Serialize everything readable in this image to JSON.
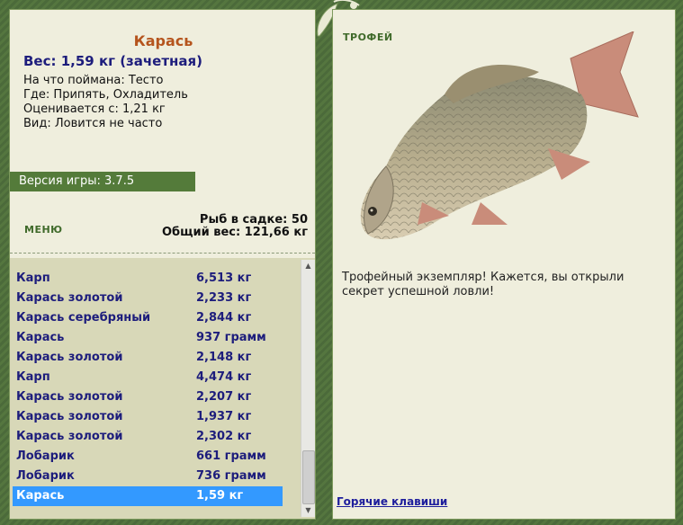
{
  "left": {
    "fish_name": "Карась",
    "weight_line": "Вес: 1,59 кг (зачетная)",
    "info": [
      "На что поймана: Тесто",
      "Где: Припять, Охладитель",
      "Оценивается с: 1,21 кг",
      "Вид: Ловится не часто"
    ],
    "version": "Версия игры: 3.7.5",
    "menu_label": "МЕНЮ",
    "stats": {
      "keepnet": "Рыб в садке: 50",
      "total": "Общий вес: 121,66 кг"
    }
  },
  "catch_list": [
    {
      "name": "Карп",
      "weight": "6,513 кг"
    },
    {
      "name": "Карась золотой",
      "weight": "2,233 кг"
    },
    {
      "name": "Карась серебряный",
      "weight": "2,844 кг"
    },
    {
      "name": "Карась",
      "weight": "937 грамм"
    },
    {
      "name": "Карась золотой",
      "weight": "2,148 кг"
    },
    {
      "name": "Карп",
      "weight": "4,474 кг"
    },
    {
      "name": "Карась золотой",
      "weight": "2,207 кг"
    },
    {
      "name": "Карась золотой",
      "weight": "1,937 кг"
    },
    {
      "name": "Карась золотой",
      "weight": "2,302 кг"
    },
    {
      "name": "Лобарик",
      "weight": "661 грамм"
    },
    {
      "name": "Лобарик",
      "weight": "736 грамм"
    },
    {
      "name": "Карась",
      "weight": "1,59 кг"
    }
  ],
  "selected_index": 11,
  "right": {
    "trophy_label": "ТРОФЕЙ",
    "trophy_text": "Трофейный экземпляр! Кажется, вы открыли секрет успешной ловли!",
    "hotkeys": "Горячие клавиши"
  },
  "colors": {
    "frame": "#4f6d3f",
    "panel": "#efeedd",
    "list_bg": "#d8d8b8",
    "selection": "#3399ff",
    "link": "#1d1d9c",
    "fish_name": "#b5541d"
  }
}
